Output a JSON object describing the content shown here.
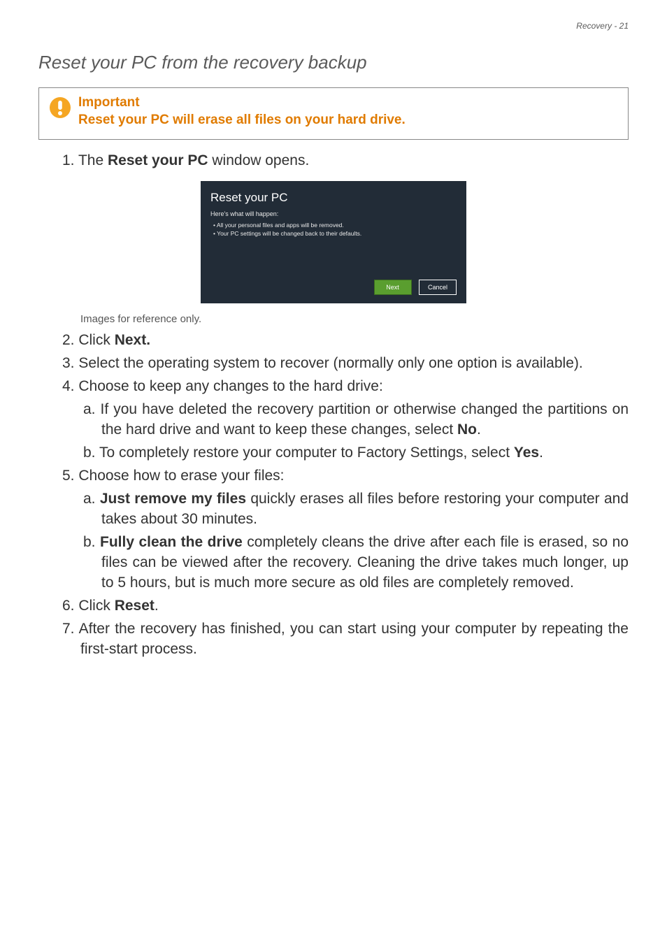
{
  "header": {
    "right": "Recovery - 21"
  },
  "section_title": "Reset your PC from the recovery backup",
  "note": {
    "title": "Important",
    "body": "Reset your PC will erase all files on your hard drive."
  },
  "steps": {
    "s1_pre": "1. The ",
    "s1_bold": "Reset your PC",
    "s1_post": " window opens.",
    "ref": "Images for reference only.",
    "s2_pre": "2. Click ",
    "s2_bold": "Next.",
    "s3": "3. Select the operating system to recover (normally only one option is available).",
    "s4": "4. Choose to keep any changes to the hard drive:",
    "s4a_pre": "a. If you have deleted the recovery partition or otherwise changed the partitions on the hard drive and want to keep these changes, select ",
    "s4a_bold": "No",
    "s4a_post": ".",
    "s4b_pre": "b. To completely restore your computer to Factory Settings, select ",
    "s4b_bold": "Yes",
    "s4b_post": ".",
    "s5": "5. Choose how to erase your files:",
    "s5a_pre": "a. ",
    "s5a_bold": "Just remove my files",
    "s5a_post": " quickly erases all files before restoring your computer and takes about 30 minutes.",
    "s5b_pre": "b. ",
    "s5b_bold": "Fully clean the drive",
    "s5b_post": " completely cleans the drive after each file is erased, so no files can be viewed after the recovery. Cleaning the drive takes much longer, up to 5 hours, but is much more secure as old files are completely removed.",
    "s6_pre": "6. Click ",
    "s6_bold": "Reset",
    "s6_post": ".",
    "s7": "7. After the recovery has finished, you can start using your computer by repeating the first-start process."
  },
  "dialog": {
    "title": "Reset your PC",
    "sub": "Here's what will happen:",
    "b1": "• All your personal files and apps will be removed.",
    "b2": "• Your PC settings will be changed back to their defaults.",
    "next": "Next",
    "cancel": "Cancel"
  }
}
